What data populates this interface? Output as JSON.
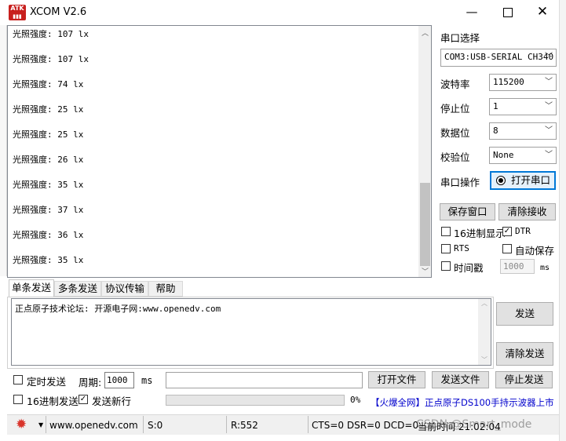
{
  "window": {
    "title": "XCOM V2.6",
    "logo_text": "ATK"
  },
  "receive_lines": [
    "光照强度: 107 lx",
    "光照强度: 107 lx",
    "光照强度: 74 lx",
    "光照强度: 25 lx",
    "光照强度: 25 lx",
    "光照强度: 26 lx",
    "光照强度: 35 lx",
    "光照强度: 37 lx",
    "光照强度: 36 lx",
    "光照强度: 35 lx"
  ],
  "port": {
    "select_label": "串口选择",
    "select_value": "COM3:USB-SERIAL CH340",
    "baud_label": "波特率",
    "baud_value": "115200",
    "stop_label": "停止位",
    "stop_value": "1",
    "data_label": "数据位",
    "data_value": "8",
    "parity_label": "校验位",
    "parity_value": "None",
    "op_label": "串口操作",
    "open_button": "打开串口",
    "save_window": "保存窗口",
    "clear_receive": "清除接收",
    "hex_display": "16进制显示",
    "dtr": "DTR",
    "rts": "RTS",
    "auto_save": "自动保存",
    "timestamp": "时间戳",
    "timestamp_value": "1000",
    "ms": "ms"
  },
  "tabs": [
    "单条发送",
    "多条发送",
    "协议传输",
    "帮助"
  ],
  "send": {
    "text": "正点原子技术论坛: 开源电子网:www.openedv.com",
    "send_button": "发送",
    "clear_send_button": "清除发送",
    "timed_send": "定时发送",
    "period_label": "周期:",
    "period_value": "1000",
    "ms": "ms",
    "open_file": "打开文件",
    "send_file": "发送文件",
    "stop_send": "停止发送",
    "hex_send": "16进制发送",
    "send_newline": "发送新行",
    "progress_percent": "0%",
    "ad_text": "【火爆全网】正点原子DS100手持示波器上市"
  },
  "status": {
    "url": "www.openedv.com",
    "sent": "S:0",
    "received": "R:552",
    "lines": "CTS=0 DSR=0 DCD=0",
    "time": "当前时间 21:02:04",
    "watermark": "CSDN @Smart_mode"
  },
  "colors": {
    "accent": "#0078d7",
    "ad_text": "#0000cc",
    "gear": "#d9342b"
  }
}
